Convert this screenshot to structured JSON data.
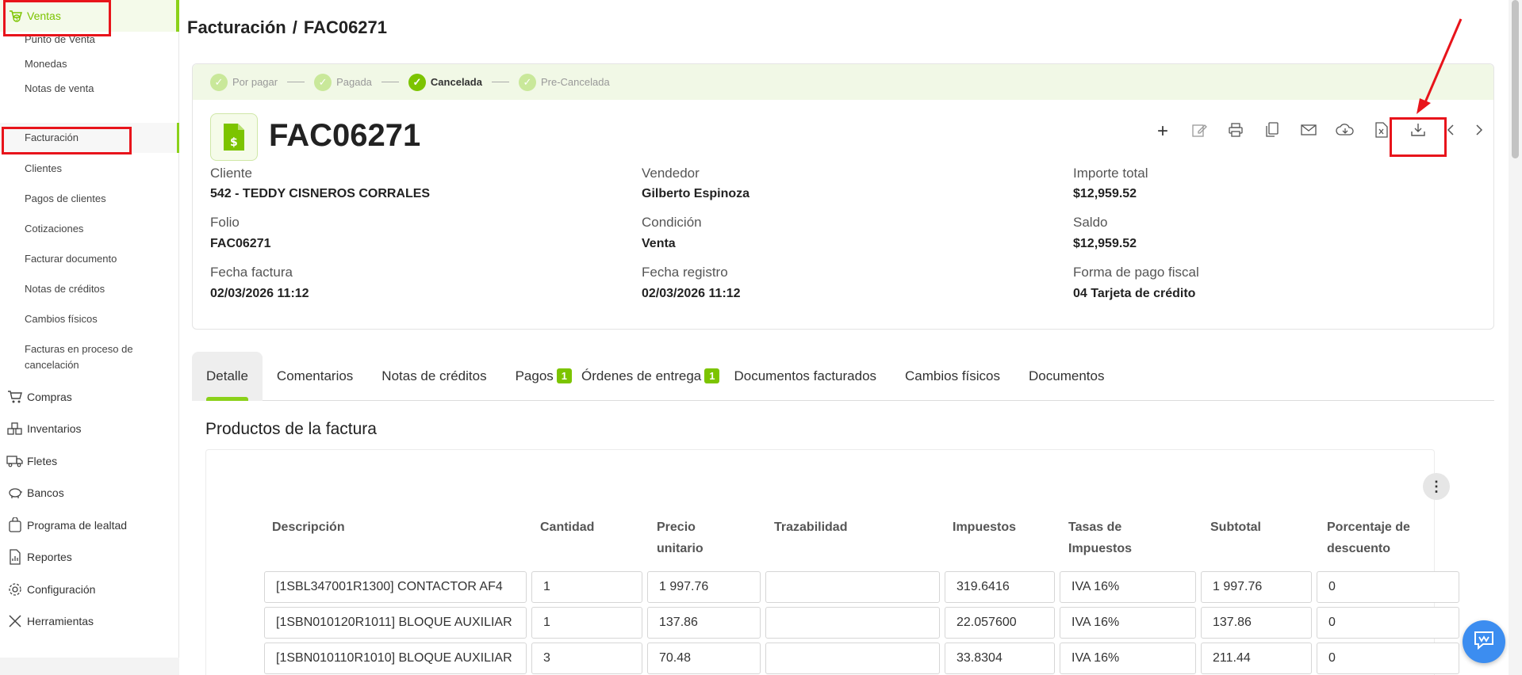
{
  "sidebar": {
    "ventas": "Ventas",
    "sub_items": [
      "Punto de Venta",
      "Monedas",
      "Notas de venta",
      "Facturación",
      "Clientes",
      "Pagos de clientes",
      "Cotizaciones",
      "Facturar documento",
      "Notas de créditos",
      "Cambios físicos"
    ],
    "sub_multiline_1": "Facturas en proceso de",
    "sub_multiline_2": "cancelación",
    "sections": [
      {
        "label": "Compras",
        "icon": "cart-icon"
      },
      {
        "label": "Inventarios",
        "icon": "boxes-icon"
      },
      {
        "label": "Fletes",
        "icon": "truck-icon"
      },
      {
        "label": "Bancos",
        "icon": "piggy-bank-icon"
      },
      {
        "label": "Programa de lealtad",
        "icon": "loyalty-icon"
      },
      {
        "label": "Reportes",
        "icon": "report-icon"
      },
      {
        "label": "Configuración",
        "icon": "gear-icon"
      },
      {
        "label": "Herramientas",
        "icon": "tools-icon"
      }
    ]
  },
  "header": {
    "breadcrumb_parent": "Facturación",
    "separator": "/",
    "breadcrumb_current": "FAC06271"
  },
  "status_steps": [
    {
      "label": "Por pagar",
      "done": false
    },
    {
      "label": "Pagada",
      "done": false
    },
    {
      "label": "Cancelada",
      "done": true
    },
    {
      "label": "Pre-Cancelada",
      "done": false
    }
  ],
  "document": {
    "number": "FAC06271",
    "icon": "invoice-dollar-icon"
  },
  "toolbar": [
    "plus-icon",
    "edit-icon",
    "print-icon",
    "copy-icon",
    "mail-icon",
    "cloud-download-icon",
    "excel-icon",
    "download-icon",
    "chevron-left-icon",
    "chevron-right-icon"
  ],
  "fields": {
    "cliente_label": "Cliente",
    "cliente_value": "542 - TEDDY CISNEROS CORRALES",
    "folio_label": "Folio",
    "folio_value": "FAC06271",
    "fecha_factura_label": "Fecha factura",
    "fecha_factura_value": "02/03/2026 11:12",
    "vendedor_label": "Vendedor",
    "vendedor_value": "Gilberto Espinoza",
    "condicion_label": "Condición",
    "condicion_value": "Venta",
    "fecha_registro_label": "Fecha registro",
    "fecha_registro_value": "02/03/2026 11:12",
    "importe_label": "Importe total",
    "importe_value": "$12,959.52",
    "saldo_label": "Saldo",
    "saldo_value": "$12,959.52",
    "forma_pago_label": "Forma de pago fiscal",
    "forma_pago_value": "04 Tarjeta de crédito"
  },
  "tabs": [
    {
      "label": "Detalle",
      "badge": null,
      "active": true
    },
    {
      "label": "Comentarios",
      "badge": null
    },
    {
      "label": "Notas de créditos",
      "badge": null
    },
    {
      "label": "Pagos",
      "badge": "1"
    },
    {
      "label": "Órdenes de entrega",
      "badge": "1"
    },
    {
      "label": "Documentos facturados",
      "badge": null
    },
    {
      "label": "Cambios físicos",
      "badge": null
    },
    {
      "label": "Documentos",
      "badge": null
    }
  ],
  "products": {
    "title": "Productos de la factura",
    "headers": {
      "descripcion": "Descripción",
      "cantidad": "Cantidad",
      "precio_1": "Precio",
      "precio_2": "unitario",
      "trazabilidad": "Trazabilidad",
      "impuestos": "Impuestos",
      "tasas_1": "Tasas de",
      "tasas_2": "Impuestos",
      "subtotal": "Subtotal",
      "porcentaje_1": "Porcentaje de",
      "porcentaje_2": "descuento"
    },
    "rows": [
      {
        "descripcion": "[1SBL347001R1300] CONTACTOR AF4",
        "cantidad": "1",
        "precio": "1 997.76",
        "trazabilidad": "",
        "impuestos": "319.6416",
        "tasa": "IVA 16%",
        "subtotal": "1 997.76",
        "descuento": "0"
      },
      {
        "descripcion": "[1SBN010120R1011] BLOQUE AUXILIAR",
        "cantidad": "1",
        "precio": "137.86",
        "trazabilidad": "",
        "impuestos": "22.057600",
        "tasa": "IVA 16%",
        "subtotal": "137.86",
        "descuento": "0"
      },
      {
        "descripcion": "[1SBN010110R1010] BLOQUE AUXILIAR",
        "cantidad": "3",
        "precio": "70.48",
        "trazabilidad": "",
        "impuestos": "33.8304",
        "tasa": "IVA 16%",
        "subtotal": "211.44",
        "descuento": "0"
      }
    ]
  },
  "colors": {
    "accent": "#7cc400",
    "annotation_red": "#e8141b",
    "chat_blue": "#3c8df0"
  }
}
